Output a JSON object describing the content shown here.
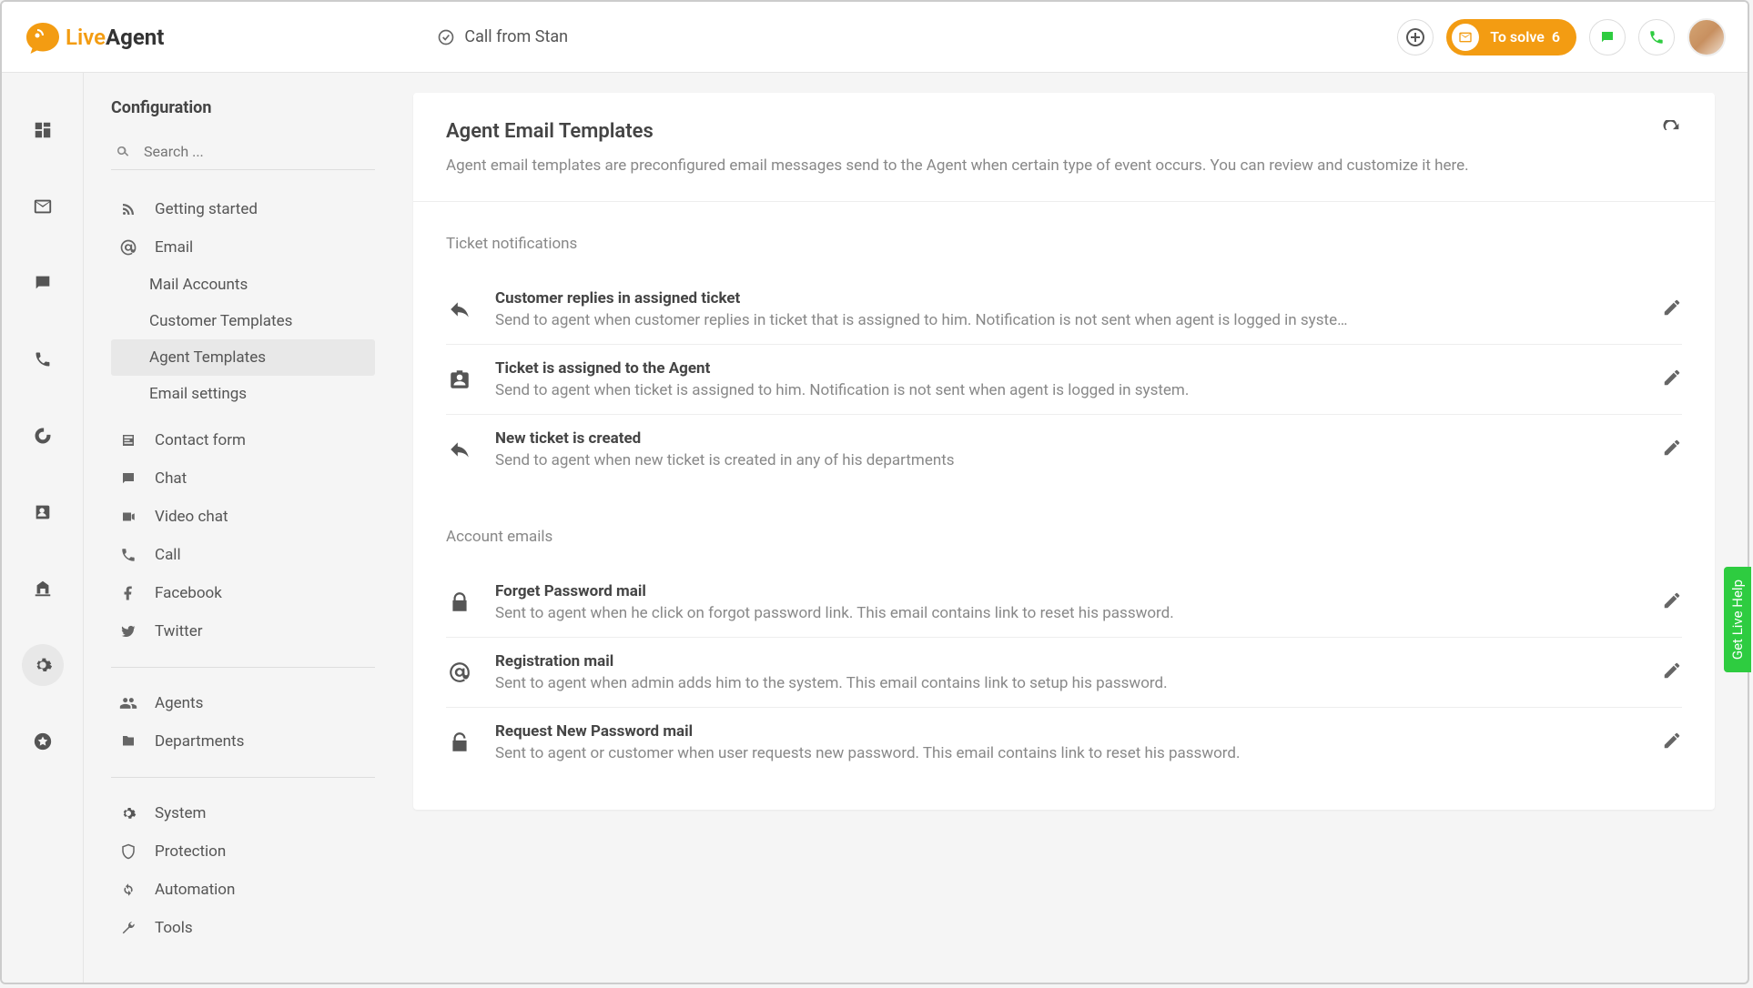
{
  "header": {
    "logo_live": "Live",
    "logo_agent": "Agent",
    "breadcrumb": "Call from Stan",
    "to_solve_label": "To solve",
    "to_solve_count": "6"
  },
  "sidebar": {
    "title": "Configuration",
    "search_placeholder": "Search ...",
    "items": [
      {
        "label": "Getting started",
        "icon": "rss"
      },
      {
        "label": "Email",
        "icon": "at"
      }
    ],
    "email_sub": [
      {
        "label": "Mail Accounts"
      },
      {
        "label": "Customer Templates"
      },
      {
        "label": "Agent Templates"
      },
      {
        "label": "Email settings"
      }
    ],
    "items2": [
      {
        "label": "Contact form",
        "icon": "form"
      },
      {
        "label": "Chat",
        "icon": "chat"
      },
      {
        "label": "Video chat",
        "icon": "video"
      },
      {
        "label": "Call",
        "icon": "phone"
      },
      {
        "label": "Facebook",
        "icon": "facebook"
      },
      {
        "label": "Twitter",
        "icon": "twitter"
      }
    ],
    "items3": [
      {
        "label": "Agents",
        "icon": "people"
      },
      {
        "label": "Departments",
        "icon": "folder"
      }
    ],
    "items4": [
      {
        "label": "System",
        "icon": "gear"
      },
      {
        "label": "Protection",
        "icon": "shield"
      },
      {
        "label": "Automation",
        "icon": "sync"
      },
      {
        "label": "Tools",
        "icon": "wrench"
      }
    ]
  },
  "main": {
    "title": "Agent Email Templates",
    "desc": "Agent email templates are preconfigured email messages send to the Agent when certain type of event occurs. You can review and customize it here.",
    "section1_label": "Ticket notifications",
    "section1": [
      {
        "title": "Customer replies in assigned ticket",
        "desc": "Send to agent when customer replies in ticket that is assigned to him. Notification is not sent when agent is logged in syste…",
        "icon": "reply"
      },
      {
        "title": "Ticket is assigned to the Agent",
        "desc": "Send to agent when ticket is assigned to him. Notification is not sent when agent is logged in system.",
        "icon": "badge"
      },
      {
        "title": "New ticket is created",
        "desc": "Send to agent when new ticket is created in any of his departments",
        "icon": "reply"
      }
    ],
    "section2_label": "Account emails",
    "section2": [
      {
        "title": "Forget Password mail",
        "desc": "Sent to agent when he click on forgot password link. This email contains link to reset his password.",
        "icon": "lock"
      },
      {
        "title": "Registration mail",
        "desc": "Sent to agent when admin adds him to the system. This email contains link to setup his password.",
        "icon": "at"
      },
      {
        "title": "Request New Password mail",
        "desc": "Sent to agent or customer when user requests new password. This email contains link to reset his password.",
        "icon": "unlock"
      }
    ]
  },
  "help_tab": "Get Live Help"
}
